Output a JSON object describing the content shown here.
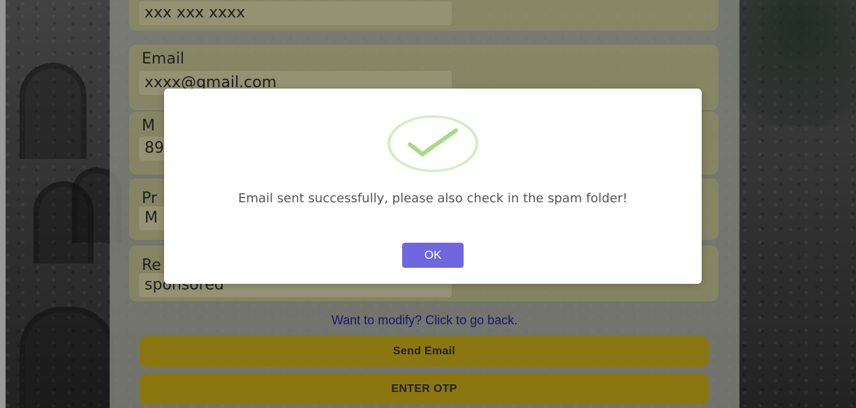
{
  "form": {
    "phone_value": "xxx xxx xxxx",
    "email_label": "Email",
    "email_value": "xxxx@gmail.com",
    "mobile_label_partial": "M",
    "mobile_value_partial": "89",
    "program_label_partial": "Pr",
    "program_value_partial": "M",
    "reason_label_partial": "Re",
    "reason_value": "sponsored",
    "back_link": "Want to modify? Click to go back.",
    "send_email_button": "Send Email",
    "enter_otp_button": "ENTER OTP"
  },
  "modal": {
    "icon": "success-check-icon",
    "message": "Email sent successfully, please also check in the spam folder!",
    "ok_button": "OK"
  },
  "colors": {
    "confirm_button": "#7066e0",
    "action_button": "#e8c61c",
    "check": "#a5dc86",
    "link": "#2a2ab8"
  }
}
